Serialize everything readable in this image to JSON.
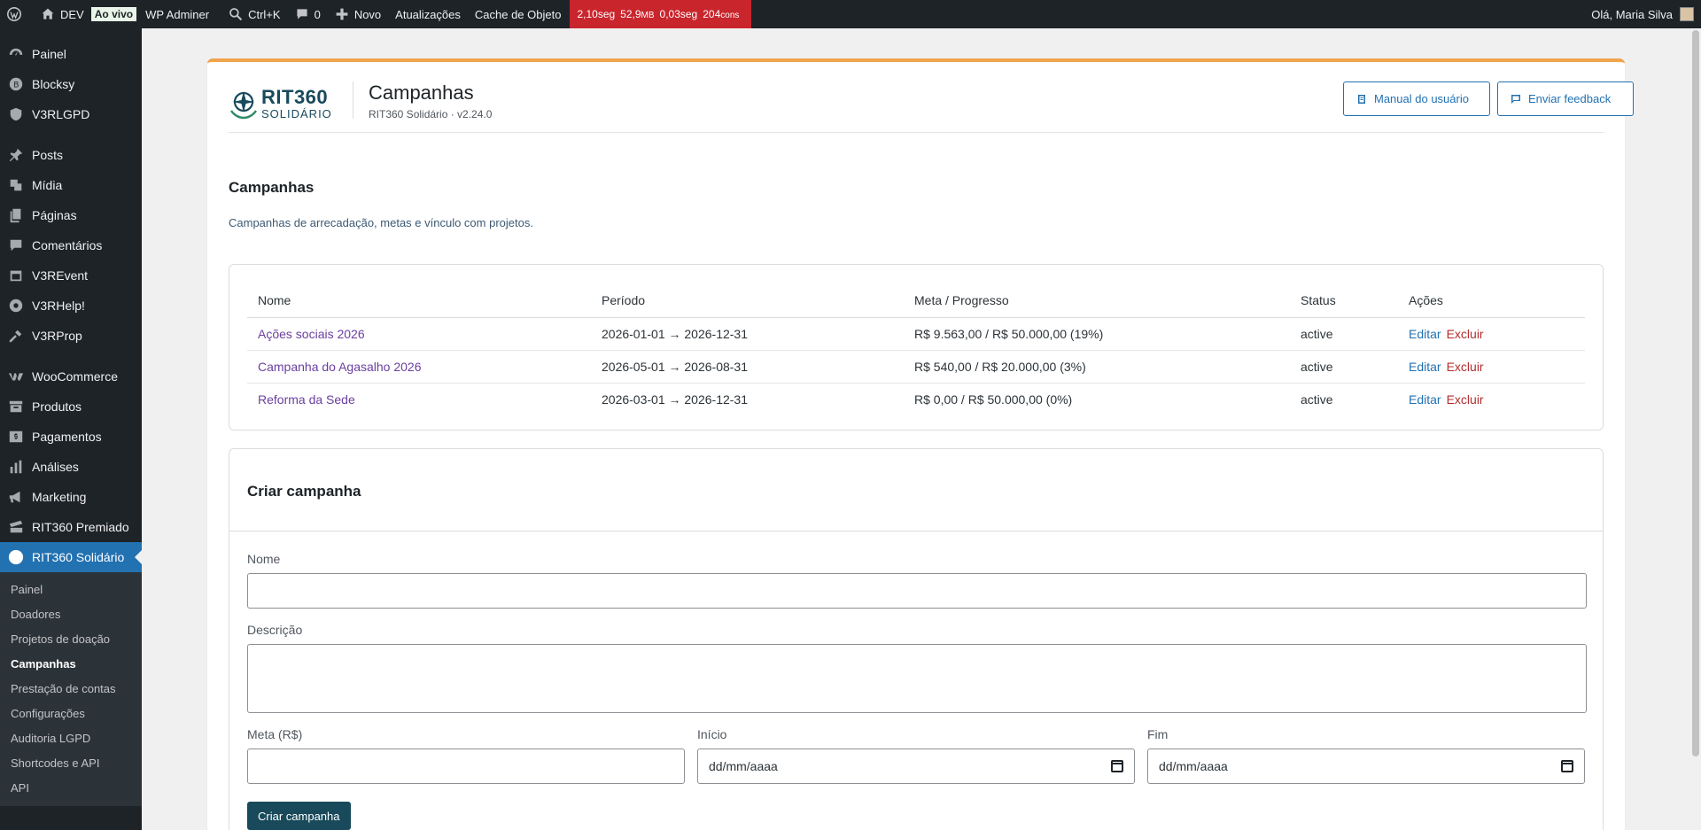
{
  "adminbar": {
    "site_name": "DEV",
    "live_badge": "Ao vivo",
    "wp_adminer": "WP Adminer",
    "search_shortcut": "Ctrl+K",
    "comments_count": "0",
    "new_label": "Novo",
    "updates": "Atualizações",
    "object_cache": "Cache de Objeto",
    "perf": {
      "time": "2,10seg",
      "memory": "52,9",
      "memory_unit": "MB",
      "query_time": "0,03seg",
      "queries": "204",
      "queries_unit": "cons"
    },
    "greeting": "Olá, Maria Silva"
  },
  "sidebar": {
    "items": [
      {
        "label": "Painel",
        "icon": "dashboard-icon"
      },
      {
        "label": "Blocksy",
        "icon": "blocksy-icon"
      },
      {
        "label": "V3RLGPD",
        "icon": "shield-icon"
      },
      {
        "label": "Posts",
        "icon": "pin-icon"
      },
      {
        "label": "Mídia",
        "icon": "media-icon"
      },
      {
        "label": "Páginas",
        "icon": "pages-icon"
      },
      {
        "label": "Comentários",
        "icon": "comment-icon"
      },
      {
        "label": "V3REvent",
        "icon": "calendar-icon"
      },
      {
        "label": "V3RHelp!",
        "icon": "help-icon"
      },
      {
        "label": "V3RProp",
        "icon": "key-icon"
      },
      {
        "label": "WooCommerce",
        "icon": "woo-icon"
      },
      {
        "label": "Produtos",
        "icon": "archive-icon"
      },
      {
        "label": "Pagamentos",
        "icon": "dollar-icon"
      },
      {
        "label": "Análises",
        "icon": "chart-icon"
      },
      {
        "label": "Marketing",
        "icon": "megaphone-icon"
      },
      {
        "label": "RIT360 Premiado",
        "icon": "ticket-icon"
      },
      {
        "label": "RIT360 Solidário",
        "icon": "circle-icon"
      }
    ],
    "submenu": [
      "Painel",
      "Doadores",
      "Projetos de doação",
      "Campanhas",
      "Prestação de contas",
      "Configurações",
      "Auditoria LGPD",
      "Shortcodes e API",
      "API"
    ],
    "active_submenu": "Campanhas"
  },
  "header": {
    "logo_main": "RIT360",
    "logo_sub": "SOLIDÁRIO",
    "title": "Campanhas",
    "subtitle": "RIT360 Solidário · v2.24.0",
    "manual_button": "Manual do usuário",
    "feedback_button": "Enviar feedback"
  },
  "section": {
    "title": "Campanhas",
    "description": "Campanhas de arrecadação, metas e vínculo com projetos."
  },
  "table": {
    "columns": [
      "Nome",
      "Período",
      "Meta / Progresso",
      "Status",
      "Ações"
    ],
    "rows": [
      {
        "name": "Ações sociais 2026",
        "period": "2026-01-01 → 2026-12-31",
        "progress": "R$ 9.563,00 / R$ 50.000,00 (19%)",
        "status": "active"
      },
      {
        "name": "Campanha do Agasalho 2026",
        "period": "2026-05-01 → 2026-08-31",
        "progress": "R$ 540,00 / R$ 20.000,00 (3%)",
        "status": "active"
      },
      {
        "name": "Reforma da Sede",
        "period": "2026-03-01 → 2026-12-31",
        "progress": "R$ 0,00 / R$ 50.000,00 (0%)",
        "status": "active"
      }
    ],
    "edit_label": "Editar",
    "delete_label": "Excluir"
  },
  "form": {
    "title": "Criar campanha",
    "name_label": "Nome",
    "name_value": "",
    "description_label": "Descrição",
    "description_value": "",
    "goal_label": "Meta (R$)",
    "goal_value": "",
    "start_label": "Início",
    "start_placeholder": "dd/mm/aaaa",
    "end_label": "Fim",
    "end_placeholder": "dd/mm/aaaa",
    "submit_label": "Criar campanha"
  },
  "colors": {
    "accent": "#2271b1",
    "brand": "#184a5b",
    "card_top_border": "#f0a44b",
    "perf_bg": "#c9252c"
  }
}
